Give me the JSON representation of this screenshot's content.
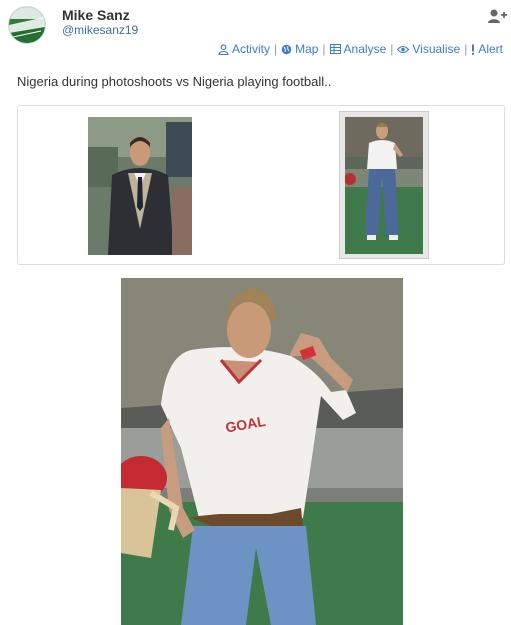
{
  "user": {
    "name": "Mike Sanz",
    "handle": "@mikesanz19",
    "avatar_icon": "stadium-avatar-icon"
  },
  "actions": [
    {
      "label": "Activity",
      "icon": "person-icon"
    },
    {
      "label": "Map",
      "icon": "globe-icon"
    },
    {
      "label": "Analyse",
      "icon": "table-icon"
    },
    {
      "label": "Visualise",
      "icon": "eye-icon"
    },
    {
      "label": "Alert",
      "icon": "exclamation-icon"
    }
  ],
  "tweet": {
    "text": "Nigeria during photoshoots vs Nigeria playing football.."
  },
  "images": {
    "photo_1": "man-in-suit-photo",
    "photo_2": "man-in-goal-shirt-photo",
    "photo_large": "man-in-goal-shirt-large-photo",
    "shirt_text": "GOAL"
  },
  "colors": {
    "link": "#3a7ecb",
    "text": "#333333",
    "border": "#dddddd"
  }
}
